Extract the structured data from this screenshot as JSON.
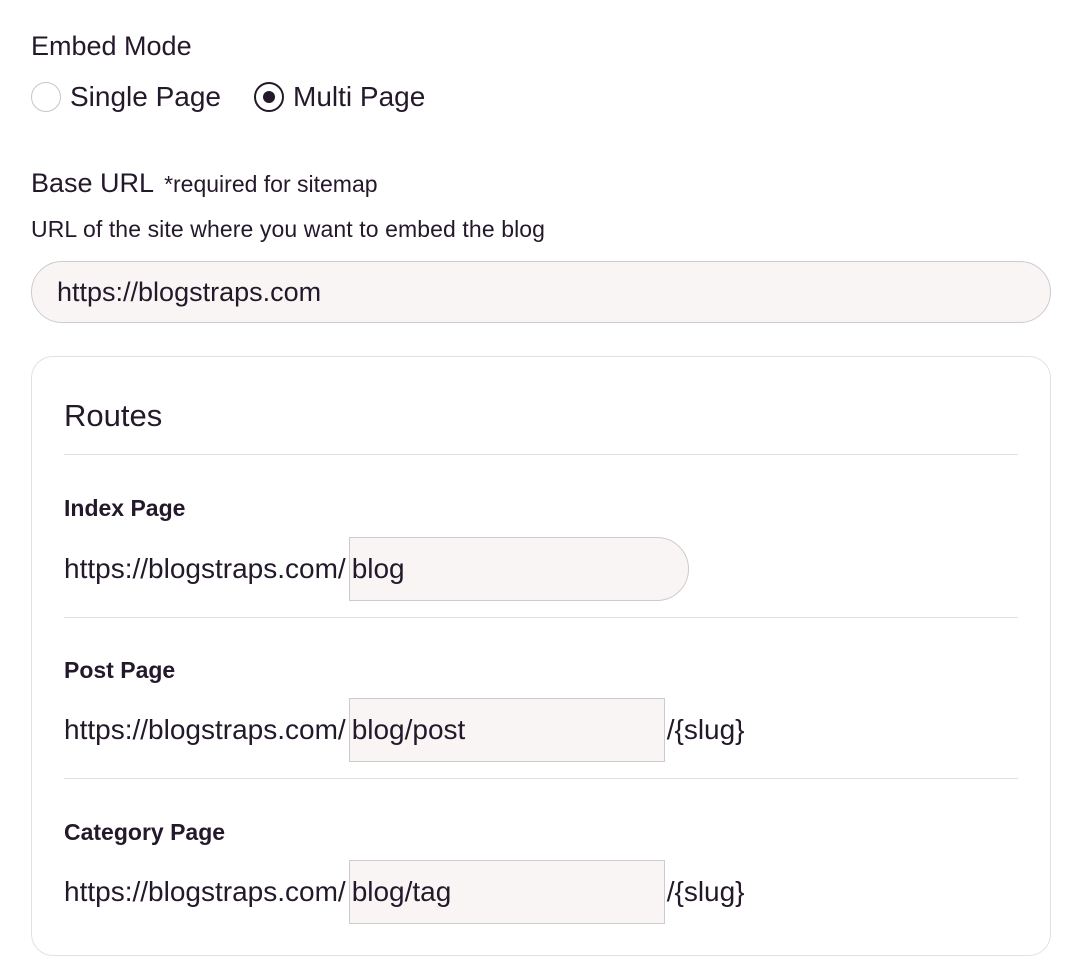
{
  "embed_mode": {
    "label": "Embed Mode",
    "options": [
      {
        "label": "Single Page",
        "checked": false
      },
      {
        "label": "Multi Page",
        "checked": true
      }
    ]
  },
  "base_url": {
    "label": "Base URL",
    "note": "*required for sitemap",
    "help": "URL of the site where you want to embed the blog",
    "value": "https://blogstraps.com"
  },
  "routes": {
    "title": "Routes",
    "index_page": {
      "label": "Index Page",
      "prefix": "https://blogstraps.com/",
      "value": "blog"
    },
    "post_page": {
      "label": "Post Page",
      "prefix": "https://blogstraps.com/",
      "value": "blog/post",
      "suffix": "/{slug}"
    },
    "category_page": {
      "label": "Category Page",
      "prefix": "https://blogstraps.com/",
      "value": "blog/tag",
      "suffix": "/{slug}"
    }
  },
  "colors": {
    "text": "#24182b",
    "input_bg": "#f9f5f4",
    "border": "#cfcad0"
  }
}
